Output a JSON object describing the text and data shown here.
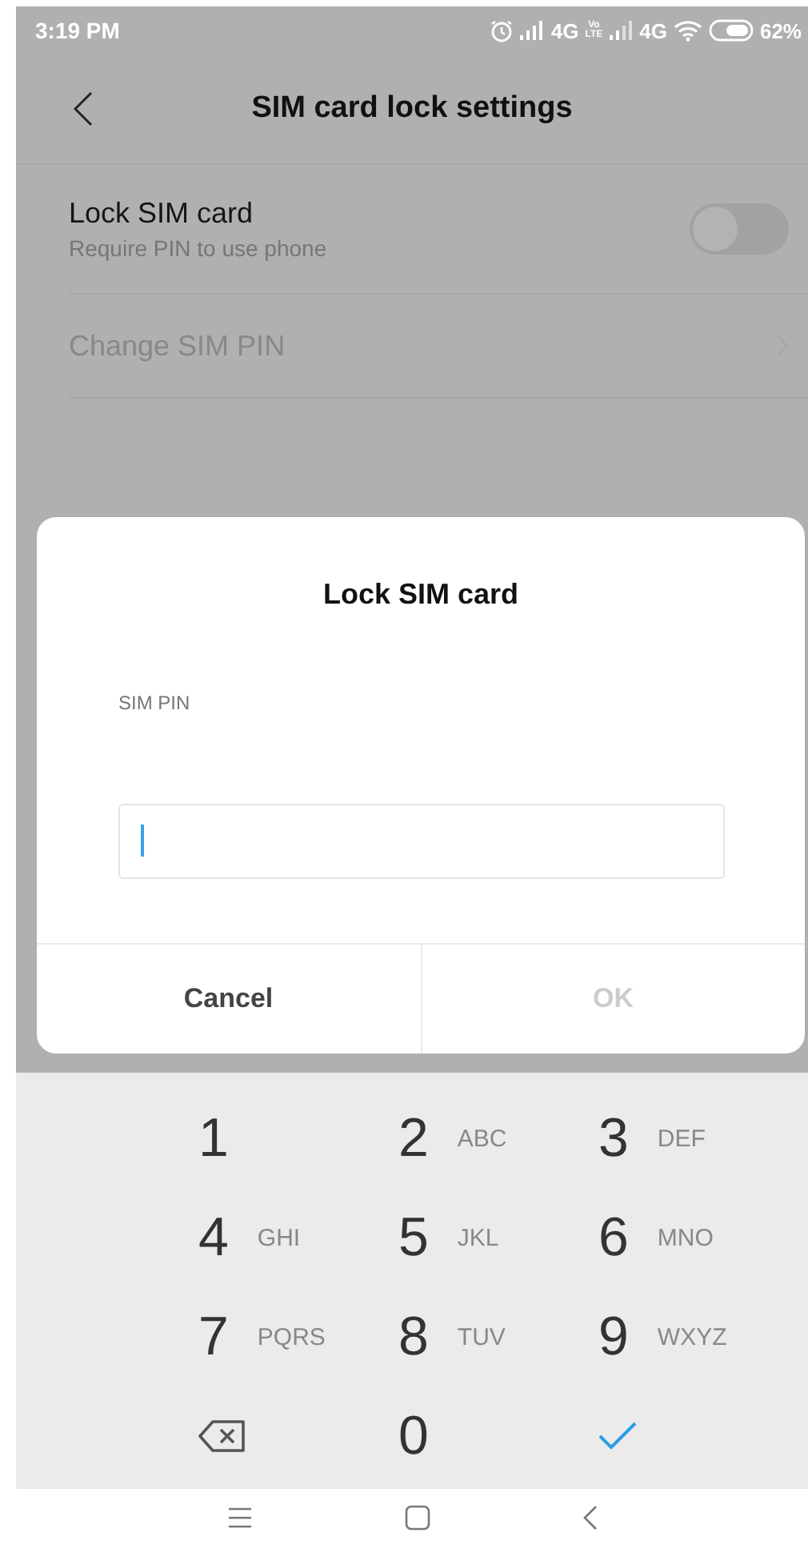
{
  "status_bar": {
    "time": "3:19 PM",
    "network_1": "4G",
    "volte": [
      "Vo",
      "LTE"
    ],
    "network_2": "4G",
    "battery": "62%"
  },
  "header": {
    "title": "SIM card lock settings"
  },
  "settings": [
    {
      "kind": "toggle",
      "title": "Lock SIM card",
      "subtitle": "Require PIN to use phone",
      "on": false,
      "disabled": false
    },
    {
      "kind": "link",
      "title": "Change SIM PIN",
      "disabled": true
    }
  ],
  "dialog": {
    "title": "Lock SIM card",
    "field_label": "SIM PIN",
    "field_focused": true,
    "buttons": [
      {
        "label": "Cancel",
        "disabled": false
      },
      {
        "label": "OK",
        "disabled": true
      }
    ]
  },
  "keypad": [
    {
      "kind": "digit",
      "digit": "1"
    },
    {
      "kind": "digit",
      "digit": "2",
      "letters": "ABC"
    },
    {
      "kind": "digit",
      "digit": "3",
      "letters": "DEF"
    },
    {
      "kind": "digit",
      "digit": "4",
      "letters": "GHI"
    },
    {
      "kind": "digit",
      "digit": "5",
      "letters": "JKL"
    },
    {
      "kind": "digit",
      "digit": "6",
      "letters": "MNO"
    },
    {
      "kind": "digit",
      "digit": "7",
      "letters": "PQRS"
    },
    {
      "kind": "digit",
      "digit": "8",
      "letters": "TUV"
    },
    {
      "kind": "digit",
      "digit": "9",
      "letters": "WXYZ"
    },
    {
      "kind": "backspace"
    },
    {
      "kind": "digit",
      "digit": "0"
    },
    {
      "kind": "done"
    }
  ]
}
